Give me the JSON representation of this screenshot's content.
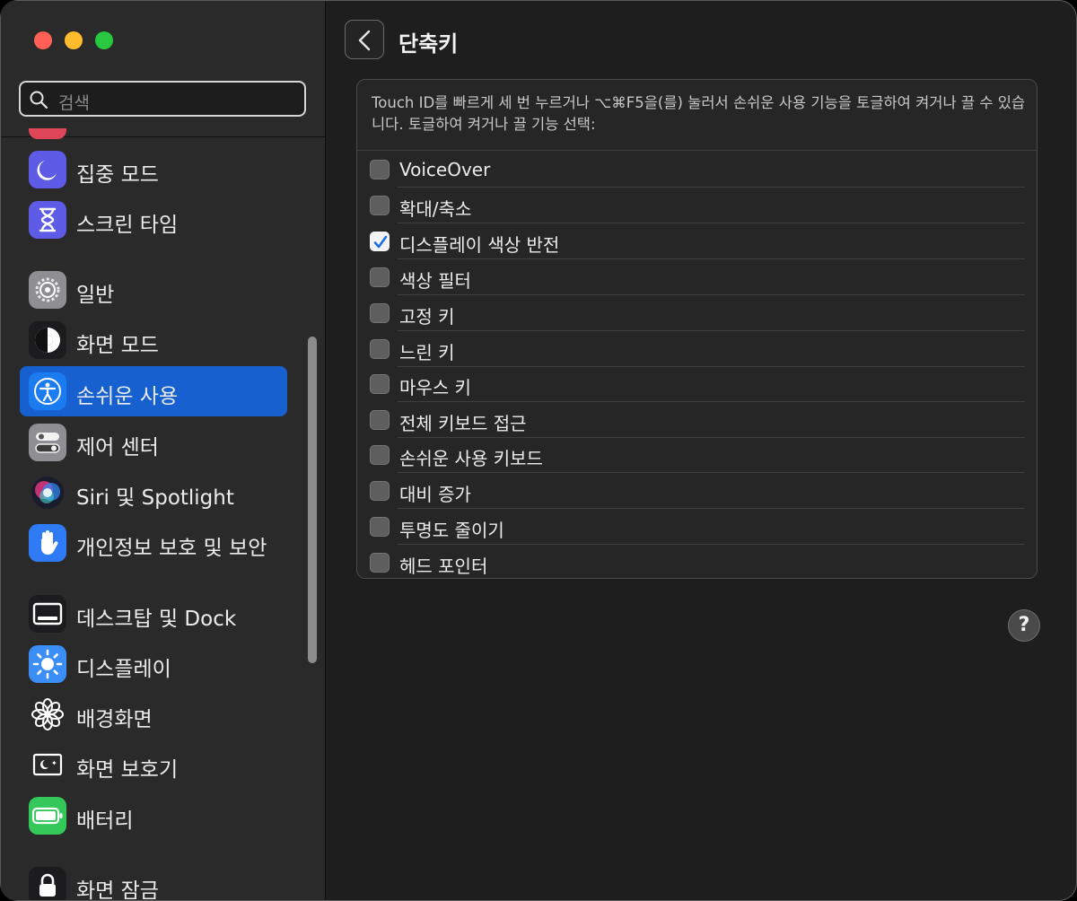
{
  "window": {
    "buttons": {
      "close": "close",
      "minimize": "minimize",
      "zoom": "zoom"
    }
  },
  "sidebar": {
    "search_placeholder": "검색",
    "items": [
      {
        "label": "집중 모드",
        "icon": "moon-icon",
        "color": "#5e5ce6",
        "selected": false
      },
      {
        "label": "스크린 타임",
        "icon": "hourglass-icon",
        "color": "#5e5ce6",
        "selected": false
      },
      {
        "label": "일반",
        "icon": "gear-icon",
        "color": "#8e8e93",
        "selected": false
      },
      {
        "label": "화면 모드",
        "icon": "appearance-icon",
        "color": "#1c1c1e",
        "selected": false
      },
      {
        "label": "손쉬운 사용",
        "icon": "accessibility-icon",
        "color": "#1a7cf0",
        "selected": true
      },
      {
        "label": "제어 센터",
        "icon": "control-center-icon",
        "color": "#8e8e93",
        "selected": false
      },
      {
        "label": "Siri 및 Spotlight",
        "icon": "siri-icon",
        "color": "#2a2a2a",
        "selected": false
      },
      {
        "label": "개인정보 보호 및 보안",
        "icon": "hand-icon",
        "color": "#2f7bf6",
        "selected": false
      },
      {
        "label": "데스크탑 및 Dock",
        "icon": "dock-icon",
        "color": "#1c1c1e",
        "selected": false
      },
      {
        "label": "디스플레이",
        "icon": "sun-icon",
        "color": "#3a8ef6",
        "selected": false
      },
      {
        "label": "배경화면",
        "icon": "flower-icon",
        "color": "#2a2a2a",
        "selected": false
      },
      {
        "label": "화면 보호기",
        "icon": "screensaver-icon",
        "color": "#2a2a2a",
        "selected": false
      },
      {
        "label": "배터리",
        "icon": "battery-icon",
        "color": "#34c759",
        "selected": false
      },
      {
        "label": "화면 잠금",
        "icon": "lock-icon",
        "color": "#1c1c1e",
        "selected": false
      }
    ]
  },
  "main": {
    "title": "단축키",
    "description": "Touch ID를 빠르게 세 번 누르거나 ⌥⌘F5을(를) 눌러서 손쉬운 사용 기능을 토글하여 켜거나 끌 수 있습니다. 토글하여 켜거나 끌 기능 선택:",
    "options": [
      {
        "label": "VoiceOver",
        "checked": false
      },
      {
        "label": "확대/축소",
        "checked": false
      },
      {
        "label": "디스플레이 색상 반전",
        "checked": true
      },
      {
        "label": "색상 필터",
        "checked": false
      },
      {
        "label": "고정 키",
        "checked": false
      },
      {
        "label": "느린 키",
        "checked": false
      },
      {
        "label": "마우스 키",
        "checked": false
      },
      {
        "label": "전체 키보드 접근",
        "checked": false
      },
      {
        "label": "손쉬운 사용 키보드",
        "checked": false
      },
      {
        "label": "대비 증가",
        "checked": false
      },
      {
        "label": "투명도 줄이기",
        "checked": false
      },
      {
        "label": "헤드 포인터",
        "checked": false
      }
    ],
    "help_label": "?"
  },
  "colors": {
    "accent": "#1660d0",
    "checkbox_checked": "#f4f4f4"
  }
}
